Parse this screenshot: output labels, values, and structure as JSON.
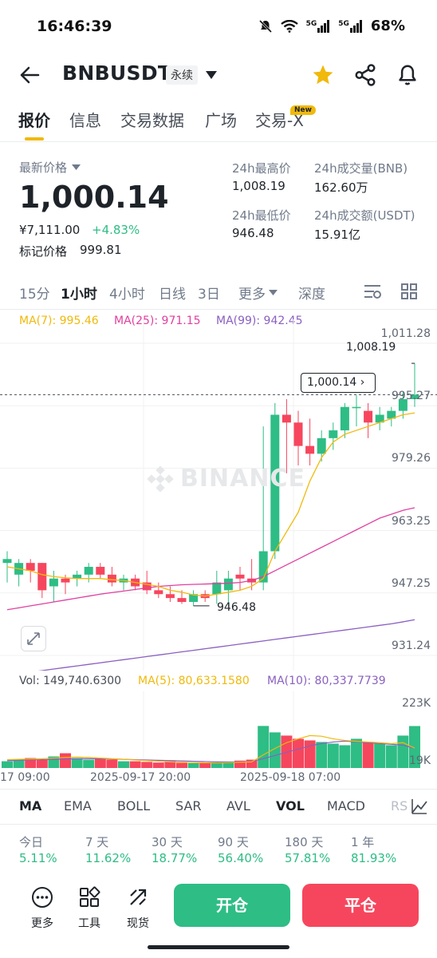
{
  "status": {
    "time": "16:46:39",
    "net1": "5G",
    "net2": "5G",
    "battery": "68%"
  },
  "header": {
    "symbol": "BNBUSDT",
    "badge": "永续"
  },
  "tabs": [
    "报价",
    "信息",
    "交易数据",
    "广场",
    "交易-X"
  ],
  "new_badge": "New",
  "price": {
    "label": "最新价格",
    "last": "1,000.14",
    "cny": "¥7,111.00",
    "change": "+4.83%",
    "mark_label": "标记价格",
    "mark_value": "999.81",
    "high_label": "24h最高价",
    "high": "1,008.19",
    "low_label": "24h最低价",
    "low": "946.48",
    "vol_label": "24h成交量(BNB)",
    "vol": "162.60万",
    "amt_label": "24h成交额(USDT)",
    "amt": "15.91亿"
  },
  "intervals": [
    "15分",
    "1小时",
    "4小时",
    "日线",
    "3日",
    "更多",
    "深度"
  ],
  "ma_legend": {
    "ma7": "MA(7): 995.46",
    "ma25": "MA(25): 971.15",
    "ma99": "MA(99): 942.45"
  },
  "watermark": "BINANCE",
  "price_axis": [
    "1,011.28",
    "995.27",
    "979.26",
    "963.25",
    "947.25",
    "931.24"
  ],
  "annotations": {
    "high": "1,008.19",
    "low": "946.48",
    "current": "1,000.14 ›"
  },
  "vol_legend": {
    "vol": "Vol: 149,740.6300",
    "ma5": "MA(5): 80,633.1580",
    "ma10": "MA(10): 80,337.7739"
  },
  "vol_axis": {
    "top": "223K",
    "bottom": "19K"
  },
  "time_axis": [
    "17 09:00",
    "2025-09-17 20:00",
    "2025-09-18 07:00"
  ],
  "indicators": [
    "MA",
    "EMA",
    "BOLL",
    "SAR",
    "AVL",
    "VOL",
    "MACD",
    "RS"
  ],
  "performance": [
    {
      "label": "今日",
      "value": "5.11%"
    },
    {
      "label": "7 天",
      "value": "11.62%"
    },
    {
      "label": "30 天",
      "value": "18.77%"
    },
    {
      "label": "90 天",
      "value": "56.40%"
    },
    {
      "label": "180 天",
      "value": "57.81%"
    },
    {
      "label": "1 年",
      "value": "81.93%"
    }
  ],
  "bottom": {
    "more": "更多",
    "tools": "工具",
    "spot": "现货",
    "open": "开仓",
    "close": "平仓"
  },
  "colors": {
    "up": "#2ebd85",
    "down": "#f6465d",
    "accent": "#f0b90b",
    "ma7": "#f0b90b",
    "ma25": "#e040a0",
    "ma99": "#8a60c0"
  },
  "chart_data": {
    "type": "candlestick",
    "candles": [
      {
        "o": 957,
        "h": 960,
        "l": 952,
        "c": 958
      },
      {
        "o": 954,
        "h": 958,
        "l": 951,
        "c": 957
      },
      {
        "o": 957,
        "h": 958,
        "l": 952,
        "c": 955
      },
      {
        "o": 957,
        "h": 957,
        "l": 948,
        "c": 950
      },
      {
        "o": 951,
        "h": 955,
        "l": 947,
        "c": 953
      },
      {
        "o": 953,
        "h": 954,
        "l": 949,
        "c": 952
      },
      {
        "o": 953,
        "h": 955,
        "l": 951,
        "c": 954
      },
      {
        "o": 954,
        "h": 957,
        "l": 952,
        "c": 956
      },
      {
        "o": 956,
        "h": 957,
        "l": 953,
        "c": 954
      },
      {
        "o": 954,
        "h": 956,
        "l": 951,
        "c": 952
      },
      {
        "o": 952,
        "h": 954,
        "l": 950,
        "c": 953
      },
      {
        "o": 953,
        "h": 954,
        "l": 950,
        "c": 951
      },
      {
        "o": 952,
        "h": 955,
        "l": 949,
        "c": 950
      },
      {
        "o": 950,
        "h": 952,
        "l": 948,
        "c": 949
      },
      {
        "o": 949,
        "h": 951,
        "l": 947,
        "c": 948
      },
      {
        "o": 948,
        "h": 950,
        "l": 946.5,
        "c": 947
      },
      {
        "o": 947,
        "h": 950,
        "l": 946,
        "c": 949
      },
      {
        "o": 949,
        "h": 950,
        "l": 947,
        "c": 948
      },
      {
        "o": 949,
        "h": 955,
        "l": 946.5,
        "c": 952
      },
      {
        "o": 950,
        "h": 955,
        "l": 946,
        "c": 953
      },
      {
        "o": 954,
        "h": 956,
        "l": 950,
        "c": 953
      },
      {
        "o": 953,
        "h": 958,
        "l": 950,
        "c": 952
      },
      {
        "o": 952,
        "h": 992,
        "l": 950,
        "c": 960
      },
      {
        "o": 960,
        "h": 998,
        "l": 958,
        "c": 995
      },
      {
        "o": 995,
        "h": 999,
        "l": 980,
        "c": 993
      },
      {
        "o": 993,
        "h": 996,
        "l": 982,
        "c": 987
      },
      {
        "o": 987,
        "h": 994,
        "l": 982,
        "c": 985
      },
      {
        "o": 985,
        "h": 991,
        "l": 983,
        "c": 989
      },
      {
        "o": 989,
        "h": 993,
        "l": 986,
        "c": 991
      },
      {
        "o": 991,
        "h": 998,
        "l": 989,
        "c": 997
      },
      {
        "o": 997,
        "h": 1000,
        "l": 992,
        "c": 997
      },
      {
        "o": 996,
        "h": 998,
        "l": 989,
        "c": 993
      },
      {
        "o": 993,
        "h": 997,
        "l": 991,
        "c": 995
      },
      {
        "o": 994,
        "h": 997,
        "l": 992,
        "c": 996
      },
      {
        "o": 996,
        "h": 1001,
        "l": 994,
        "c": 999
      },
      {
        "o": 999,
        "h": 1008.19,
        "l": 997,
        "c": 1000.14
      }
    ],
    "ma7": [
      956,
      955.5,
      955,
      954,
      953.5,
      953.2,
      953,
      953,
      953,
      952.7,
      952.5,
      952,
      951.5,
      951,
      950,
      949.5,
      948.8,
      948.5,
      949,
      949.5,
      950,
      951,
      953,
      960,
      965,
      970,
      978,
      984,
      988,
      990,
      991,
      992,
      993,
      994,
      995,
      995.46
    ],
    "ma25": [
      945,
      945.5,
      946,
      946.5,
      947,
      947.5,
      948,
      948.5,
      949,
      949.4,
      949.8,
      950.2,
      950.6,
      951,
      951.2,
      951.4,
      951.5,
      951.6,
      951.7,
      951.8,
      952,
      952.5,
      953.5,
      955,
      956.5,
      958,
      959.5,
      961,
      962.5,
      964,
      965.5,
      967,
      968.5,
      969.5,
      970.5,
      971.15
    ],
    "ma99": [
      928,
      928.5,
      929,
      929.4,
      929.8,
      930.2,
      930.6,
      931,
      931.4,
      931.8,
      932.2,
      932.6,
      933,
      933.4,
      933.8,
      934.2,
      934.6,
      935,
      935.4,
      935.8,
      936.2,
      936.6,
      937,
      937.4,
      937.8,
      938.2,
      938.6,
      939,
      939.4,
      939.8,
      940.2,
      940.6,
      941,
      941.4,
      941.9,
      942.45
    ],
    "volumes": [
      40,
      45,
      50,
      45,
      55,
      65,
      50,
      45,
      50,
      45,
      40,
      40,
      38,
      36,
      40,
      35,
      34,
      34,
      36,
      38,
      42,
      45,
      150,
      130,
      120,
      110,
      105,
      100,
      95,
      90,
      110,
      100,
      95,
      90,
      120,
      149.74
    ],
    "vol_ma5": [
      45,
      46,
      47,
      48,
      50,
      52,
      53,
      52,
      50,
      48,
      46,
      44,
      42,
      40,
      38,
      37,
      36,
      35,
      35,
      36,
      37,
      38,
      60,
      80,
      98,
      110,
      120,
      118,
      110,
      105,
      102,
      100,
      98,
      95,
      98,
      80.63
    ],
    "vol_ma10": [
      42,
      43,
      44,
      45,
      46,
      47,
      48,
      48,
      48,
      47,
      46,
      45,
      44,
      43,
      42,
      41,
      40,
      39,
      38,
      38,
      38,
      39,
      48,
      58,
      68,
      78,
      88,
      95,
      100,
      103,
      100,
      98,
      95,
      93,
      90,
      80.34
    ],
    "ylim": [
      931.24,
      1011.28
    ],
    "vlim": [
      19,
      223
    ]
  }
}
